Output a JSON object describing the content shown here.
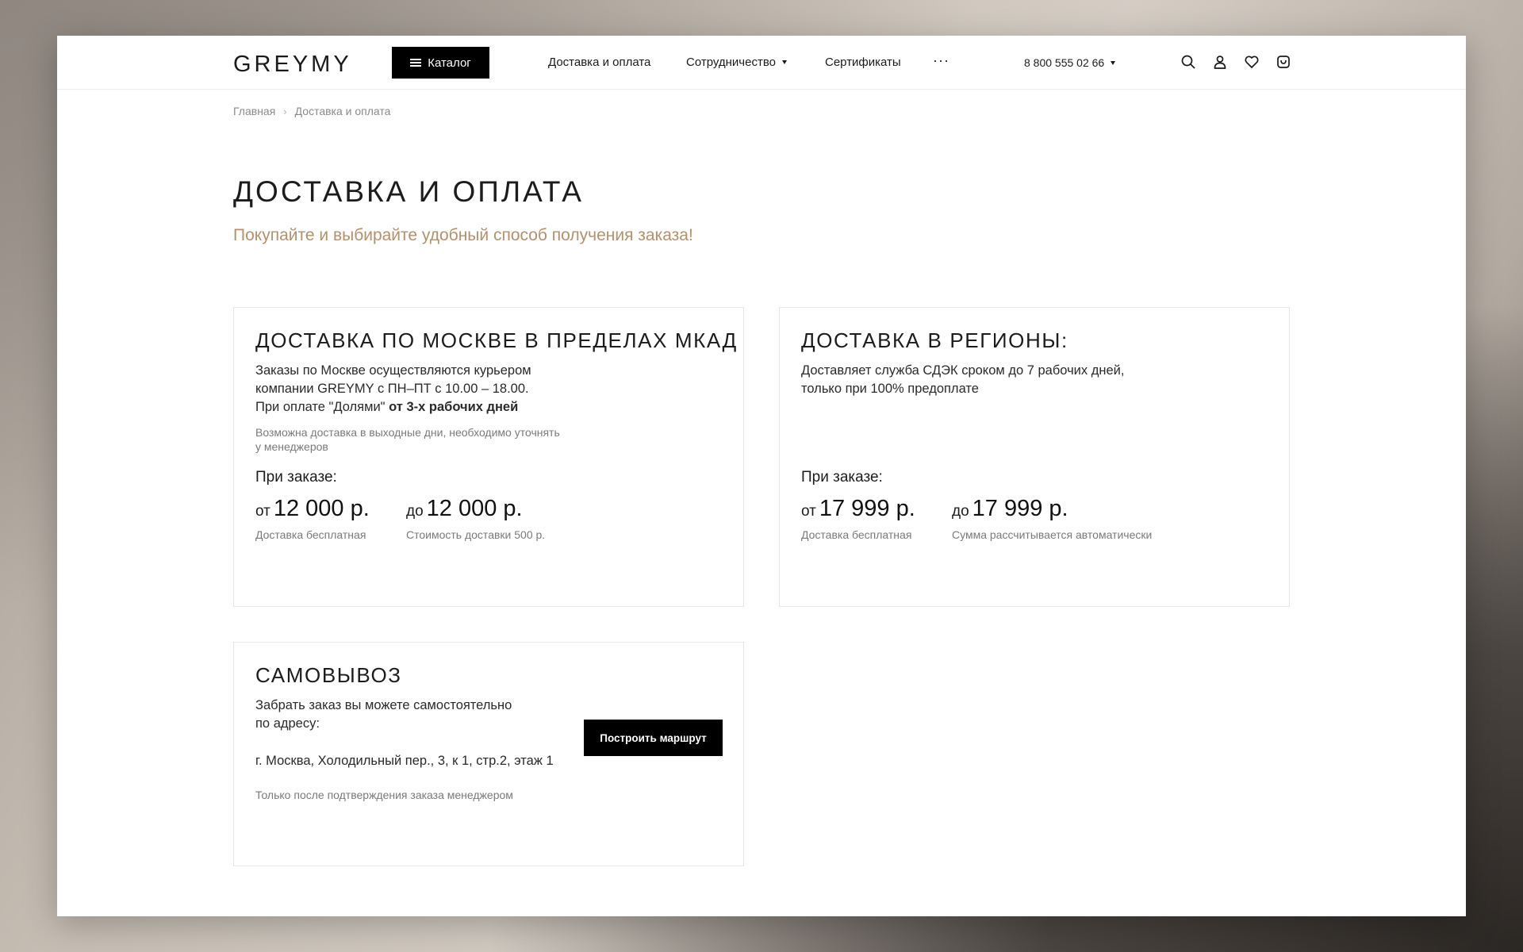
{
  "header": {
    "logo": "GREYMY",
    "catalog_label": "Каталог",
    "nav": [
      {
        "label": "Доставка и оплата"
      },
      {
        "label": "Сотрудничество"
      },
      {
        "label": "Сертификаты"
      }
    ],
    "more_label": "···",
    "phone": "8 800 555 02 66"
  },
  "breadcrumb": {
    "home": "Главная",
    "separator": "›",
    "current": "Доставка и оплата"
  },
  "page": {
    "title": "ДОСТАВКА И ОПЛАТА",
    "subtitle": "Покупайте и выбирайте удобный способ получения заказа!"
  },
  "moscow": {
    "title": "ДОСТАВКА ПО МОСКВЕ В ПРЕДЕЛАХ МКАД",
    "text_line1": "Заказы по Москве осуществляются курьером",
    "text_line2": "компании GREYMY с ПН–ПТ с 10.00 – 18.00.",
    "text_line3": "При оплате \"Долями\" ",
    "text_line3_bold": "от 3-х рабочих дней",
    "note_line1": "Возможна доставка в выходные дни, необходимо уточнять",
    "note_line2": "у менеджеров",
    "when_label": "При заказе:",
    "from_prefix": "от",
    "from_amount": "12 000 р.",
    "from_note": "Доставка бесплатная",
    "to_prefix": "до",
    "to_amount": "12 000 р.",
    "to_note": "Стоимость доставки 500 р."
  },
  "regions": {
    "title": "ДОСТАВКА В РЕГИОНЫ:",
    "text_line1": "Доставляет служба СДЭК сроком до 7 рабочих дней,",
    "text_line2": "только при 100% предоплате",
    "when_label": "При заказе:",
    "from_prefix": "от",
    "from_amount": "17 999 р.",
    "from_note": "Доставка бесплатная",
    "to_prefix": "до",
    "to_amount": "17 999 р.",
    "to_note": "Сумма рассчитывается автоматически"
  },
  "pickup": {
    "title": "САМОВЫВОЗ",
    "text_line1": "Забрать заказ вы можете самостоятельно",
    "text_line2": "по адресу:",
    "address": "г. Москва, Холодильный пер., 3, к 1, стр.2, этаж 1",
    "note": "Только после подтверждения заказа менеджером",
    "route_button": "Построить маршрут"
  },
  "icons": [
    "menu-icon",
    "chevron-down-icon",
    "more-dots-icon",
    "search-icon",
    "user-icon",
    "heart-icon",
    "cart-icon",
    "chevron-right-icon"
  ]
}
